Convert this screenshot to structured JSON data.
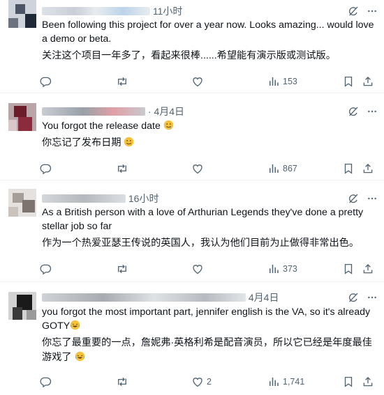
{
  "posts": [
    {
      "time": "11小时",
      "text": "Been following this project for over a year now. Looks amazing... would love a demo or beta.",
      "translation": "关注这个项目一年多了，看起来很棒......希望能有演示版或测试版。",
      "likes": "",
      "views": "153"
    },
    {
      "time": "· 4月4日",
      "text": "You forgot the release date",
      "translation": "你忘记了发布日期",
      "likes": "",
      "views": "867"
    },
    {
      "time": "16小时",
      "text": "As a British person with a love of Arthurian Legends they've done a pretty stellar job so far",
      "translation": "作为一个热爱亚瑟王传说的英国人，我认为他们目前为止做得非常出色。",
      "likes": "",
      "views": "373"
    },
    {
      "time": "4月4日",
      "text": "you forgot the most important part, jennifer english is the VA, so it's already GOTY",
      "translation": "你忘了最重要的一点，詹妮弗·英格利希是配音演员，所以它已经是年度最佳游戏了",
      "likes": "2",
      "views": "1,741"
    }
  ],
  "icons": {
    "reply": "reply-icon",
    "retweet": "retweet-icon",
    "like": "heart-icon",
    "views": "views-icon",
    "bookmark": "bookmark-icon",
    "share": "share-icon",
    "grok": "grok-icon",
    "more": "more-icon"
  },
  "colors": {
    "text": "#0f1419",
    "muted": "#536471",
    "divider": "#eff3f4"
  }
}
